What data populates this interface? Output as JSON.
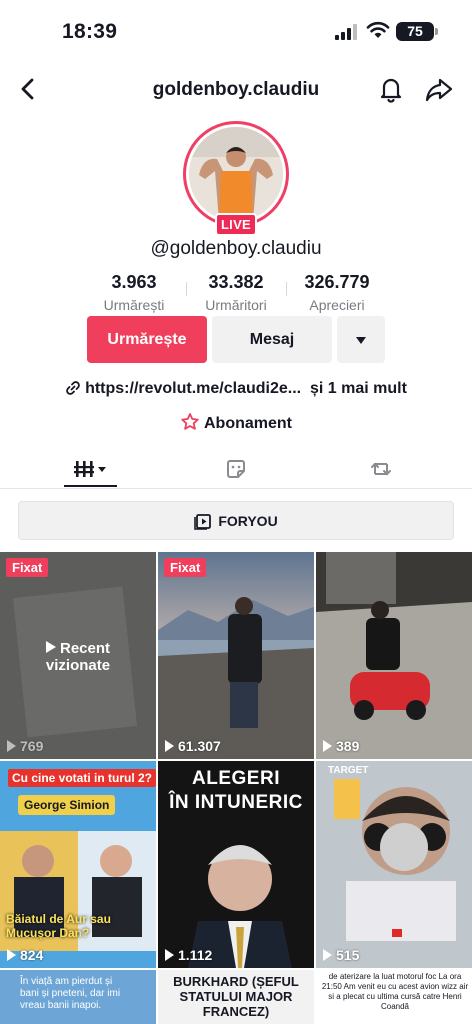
{
  "status_bar": {
    "time": "18:39",
    "battery": "75"
  },
  "header": {
    "title": "goldenboy.claudiu"
  },
  "profile": {
    "live_label": "LIVE",
    "handle": "@goldenboy.claudiu",
    "stats": [
      {
        "value": "3.963",
        "label": "Urmărești"
      },
      {
        "value": "33.382",
        "label": "Urmăritori"
      },
      {
        "value": "326.779",
        "label": "Aprecieri"
      }
    ],
    "follow_label": "Urmărește",
    "message_label": "Mesaj",
    "link_text": "https://revolut.me/claudi2e...",
    "link_more": "și 1 mai mult",
    "subscription_label": "Abonament"
  },
  "playlist": {
    "label": "FORYOU"
  },
  "videos": [
    {
      "badge": "Fixat",
      "views": "769",
      "overlay": [
        "Recent",
        "vizionate"
      ]
    },
    {
      "badge": "Fixat",
      "views": "61.307"
    },
    {
      "views": "389"
    },
    {
      "views": "824",
      "caption_top": "Cu cine votati in turul 2?",
      "caption_name": "George Simion",
      "caption_bottom": "Băiatul de Aur",
      "caption_bottom2": "sau",
      "caption_bottom3": "Mucușor Dan",
      "caption_q": "?"
    },
    {
      "views": "1.112",
      "headline": [
        "ALEGERI",
        "ÎN INTUNERIC"
      ]
    },
    {
      "views": "515",
      "tag": "TARGET"
    },
    {
      "caption": [
        "În viață am pierdut și",
        "bani și pneteni, dar imi",
        "vreau banii inapoi."
      ]
    },
    {
      "headline": [
        "BURKHARD (ȘEFUL",
        "STATULUI MAJOR",
        "FRANCEZ)"
      ]
    },
    {
      "caption": [
        "de aterizare la luat motorul foc",
        "La ora 21:50 Am venit eu cu acest avion",
        "wizz air si a plecat cu ultima cursă",
        "catre Henri Coandă"
      ]
    }
  ],
  "colors": {
    "accent": "#ef3f5c",
    "live": "#ef2b55",
    "text": "#161823",
    "muted": "#7a7b82"
  }
}
